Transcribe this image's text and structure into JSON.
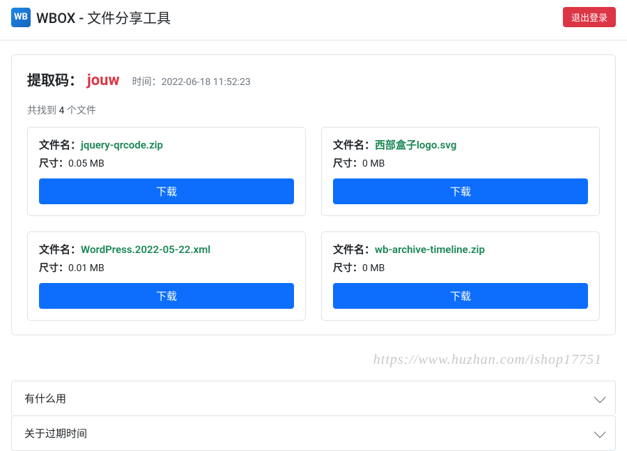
{
  "navbar": {
    "logo_text": "WB",
    "title": "WBOX - 文件分享工具",
    "logout_label": "退出登录"
  },
  "extract": {
    "label": "提取码：",
    "code": "jouw",
    "time_label": "时间：",
    "time_value": "2022-06-18 11:52:23",
    "found_prefix": "共找到 ",
    "found_count": "4",
    "found_suffix": " 个文件"
  },
  "labels": {
    "filename": "文件名：",
    "size": "尺寸：",
    "download": "下载"
  },
  "files": [
    {
      "name": "jquery-qrcode.zip",
      "size": "0.05 MB"
    },
    {
      "name": "西部盒子logo.svg",
      "size": "0 MB"
    },
    {
      "name": "WordPress.2022-05-22.xml",
      "size": "0.01 MB"
    },
    {
      "name": "wb-archive-timeline.zip",
      "size": "0 MB"
    }
  ],
  "watermark": "https://www.huzhan.com/ishop17751",
  "accordion": [
    {
      "title": "有什么用"
    },
    {
      "title": "关于过期时间"
    }
  ]
}
